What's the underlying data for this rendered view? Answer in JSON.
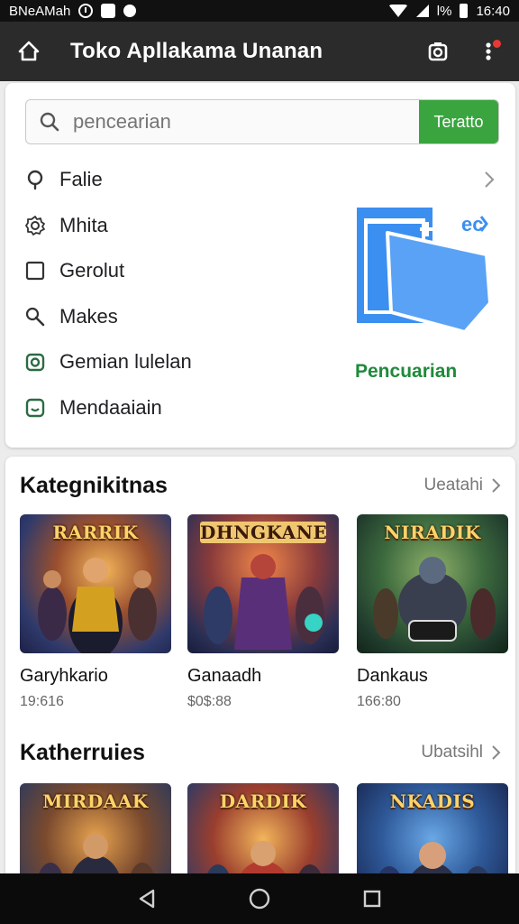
{
  "status_bar": {
    "carrier": "BNeAMah",
    "battery": "l%",
    "time": "16:40"
  },
  "app_bar": {
    "title": "Toko Apllakama Unanan"
  },
  "search": {
    "placeholder": "pencearian",
    "button_label": "Teratto"
  },
  "menu": {
    "items": [
      {
        "label": "Falie",
        "icon": "location-pin-icon"
      },
      {
        "label": "Mhita",
        "icon": "gear-icon"
      },
      {
        "label": "Gerolut",
        "icon": "checkbox-icon"
      },
      {
        "label": "Makes",
        "icon": "search-icon"
      },
      {
        "label": "Gemian lulelan",
        "icon": "camera-icon"
      },
      {
        "label": "Mendaaiain",
        "icon": "smiley-icon"
      }
    ]
  },
  "promo": {
    "badge": "ec",
    "label": "Pencuarian"
  },
  "sections": [
    {
      "title": "Kategnikitnas",
      "more_label": "Ueatahi",
      "apps": [
        {
          "banner": "RARRIK",
          "name": "Garyhkario",
          "price": "19:616"
        },
        {
          "banner": "DHNGKANE",
          "name": "Ganaadh",
          "price": "$0$:88"
        },
        {
          "banner": "NIRADIK",
          "name": "Dankaus",
          "price": "166:80"
        }
      ]
    },
    {
      "title": "Katherruies",
      "more_label": "Ubatsihl",
      "apps": [
        {
          "banner": "MIRDAAK",
          "name": "",
          "price": ""
        },
        {
          "banner": "DARDIK",
          "name": "",
          "price": ""
        },
        {
          "banner": "NKADIS",
          "name": "",
          "price": ""
        }
      ]
    }
  ],
  "colors": {
    "accent_green": "#3aa53f",
    "app_bar": "#2b2b2b",
    "promo_blue": "#3b8ff0"
  }
}
